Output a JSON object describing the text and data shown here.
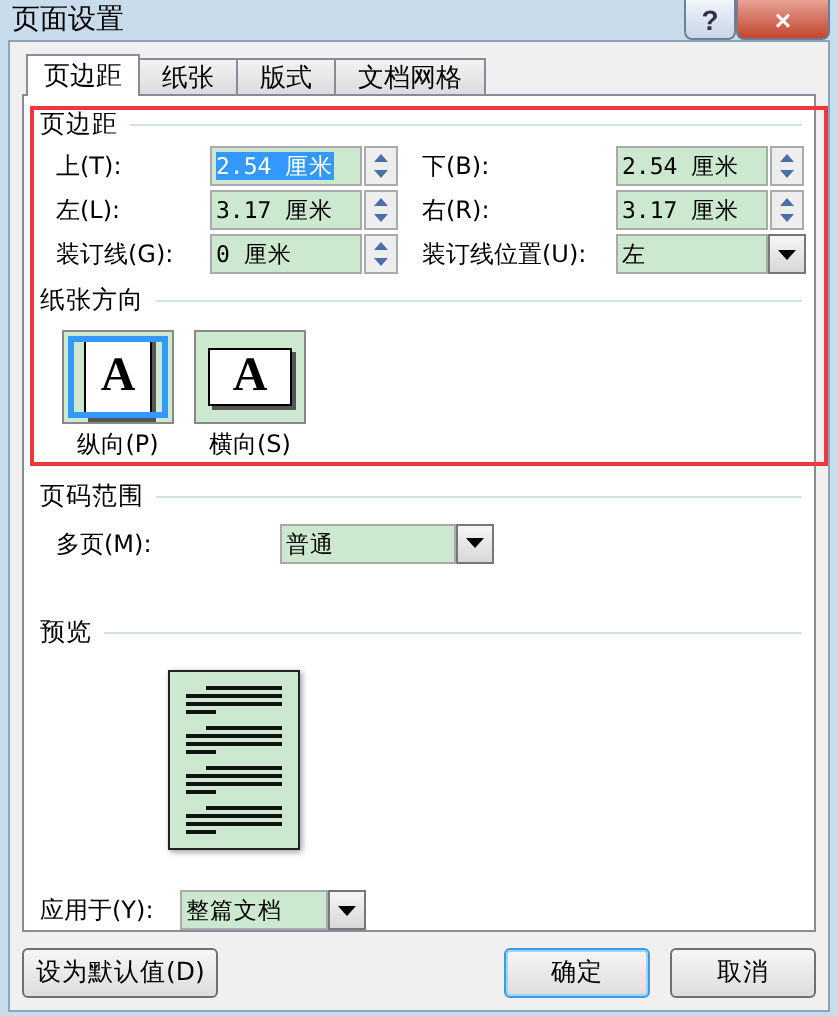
{
  "window": {
    "title": "页面设置",
    "buttons": [
      {
        "kind": "help",
        "label": "?"
      },
      {
        "kind": "close",
        "label": "×"
      }
    ]
  },
  "tabs": [
    {
      "label": "页边距",
      "selected": true
    },
    {
      "label": "纸张",
      "selected": false
    },
    {
      "label": "版式",
      "selected": false
    },
    {
      "label": "文档网格",
      "selected": false
    }
  ],
  "highlight_frame": true,
  "margins": {
    "title": "页边距",
    "fields": [
      {
        "label": "上(T):",
        "value": "2.54 厘米",
        "kind": "spin",
        "selected": true
      },
      {
        "label": "下(B):",
        "value": "2.54 厘米",
        "kind": "spin",
        "selected": false
      },
      {
        "label": "左(L):",
        "value": "3.17 厘米",
        "kind": "spin",
        "selected": false
      },
      {
        "label": "右(R):",
        "value": "3.17 厘米",
        "kind": "spin",
        "selected": false
      },
      {
        "label": "装订线(G):",
        "value": "0 厘米",
        "kind": "spin",
        "selected": false
      },
      {
        "label": "装订线位置(U):",
        "value": "左",
        "kind": "combo",
        "selected": false
      }
    ]
  },
  "orientation": {
    "title": "纸张方向",
    "options": [
      {
        "label": "纵向(P)",
        "kind": "portrait",
        "selected": true,
        "glyph": "A"
      },
      {
        "label": "横向(S)",
        "kind": "landscape",
        "selected": false,
        "glyph": "A"
      }
    ]
  },
  "pages": {
    "title": "页码范围",
    "label": "多页(M):",
    "value": "普通"
  },
  "preview": {
    "title": "预览",
    "apply_label": "应用于(Y):",
    "apply_value": "整篇文档"
  },
  "buttons": [
    {
      "label": "设为默认值(D)",
      "focused": false
    },
    {
      "label": "确定",
      "focused": true
    },
    {
      "label": "取消",
      "focused": false
    }
  ]
}
